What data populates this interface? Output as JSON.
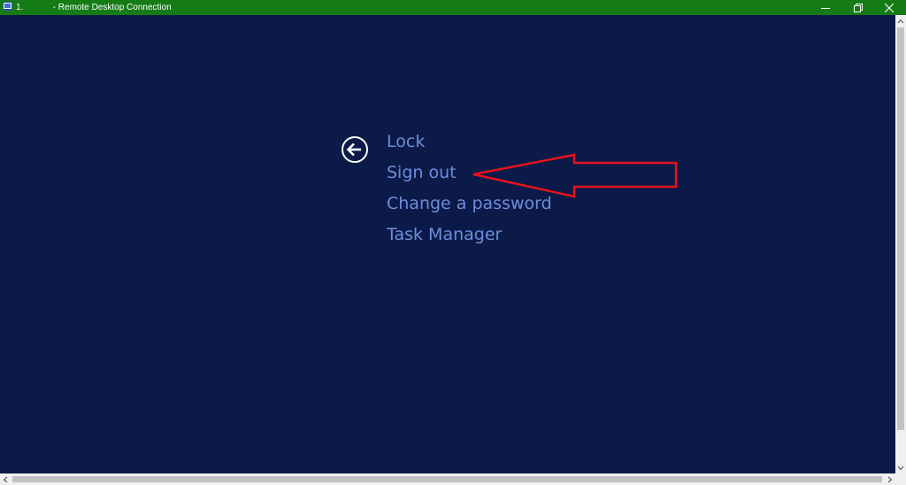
{
  "window": {
    "title": "1.            - Remote Desktop Connection",
    "minimize_icon": "minimize-icon",
    "maximize_icon": "restore-icon",
    "close_icon": "close-icon"
  },
  "security_menu": {
    "back_icon": "back-arrow-icon",
    "items": [
      {
        "label": "Lock"
      },
      {
        "label": "Sign out"
      },
      {
        "label": "Change a password"
      },
      {
        "label": "Task Manager"
      }
    ]
  },
  "annotation": {
    "type": "red-arrow",
    "points_to": "Sign out",
    "color": "#e8121b"
  },
  "colors": {
    "titlebar": "#157b15",
    "background": "#0b1a48",
    "menu_text": "#6f8ddc"
  }
}
